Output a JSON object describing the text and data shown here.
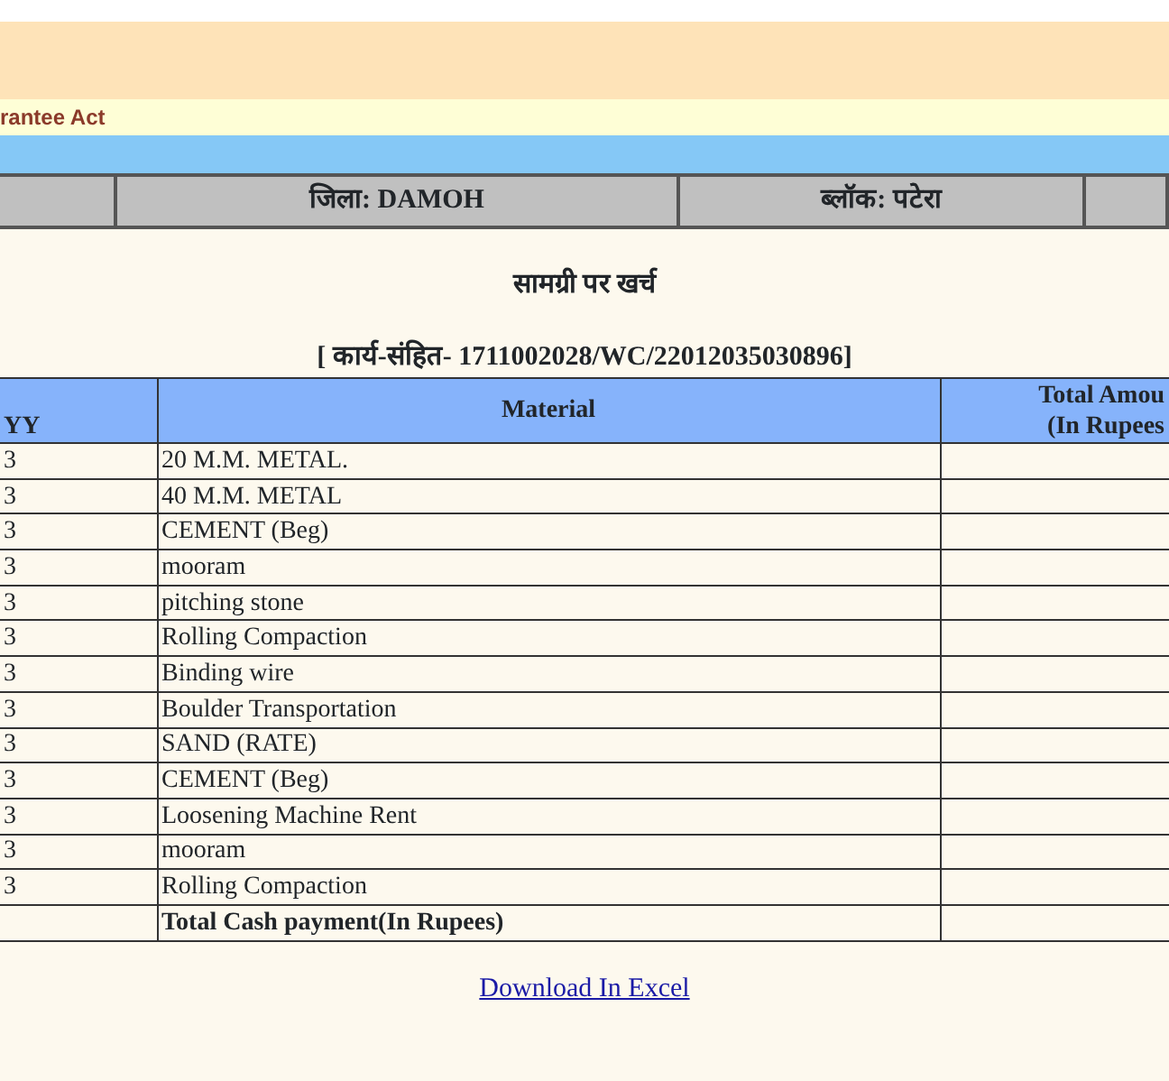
{
  "banner": {
    "text": "rantee Act"
  },
  "location_cells": [
    "जिला: DAMOH",
    "ब्लॉक: पटेरा"
  ],
  "title": "सामग्री पर खर्च",
  "work_code": "[ कार्य-संहित- 1711002028/WC/22012035030896]",
  "table": {
    "columns": [
      {
        "lines": [
          "YY"
        ]
      },
      {
        "lines": [
          "Material"
        ]
      },
      {
        "lines": [
          "Total Amou",
          "(In Rupees"
        ]
      }
    ],
    "rows": [
      {
        "column_1": "3",
        "material": "20 M.M. METAL."
      },
      {
        "column_1": "3",
        "material": "40 M.M. METAL"
      },
      {
        "column_1": "3",
        "material": "CEMENT (Beg)"
      },
      {
        "column_1": "3",
        "material": "mooram"
      },
      {
        "column_1": "3",
        "material": "pitching stone"
      },
      {
        "column_1": "3",
        "material": "Rolling Compaction"
      },
      {
        "column_1": "3",
        "material": "Binding wire"
      },
      {
        "column_1": "3",
        "material": "Boulder Transportation"
      },
      {
        "column_1": "3",
        "material": "SAND (RATE)"
      },
      {
        "column_1": "3",
        "material": "CEMENT (Beg)"
      },
      {
        "column_1": "3",
        "material": "Loosening Machine Rent"
      },
      {
        "column_1": "3",
        "material": "mooram"
      },
      {
        "column_1": "3",
        "material": "Rolling Compaction"
      }
    ],
    "total_row": {
      "label": "Total Cash payment(In Rupees)"
    }
  },
  "download_link": "Download In Excel"
}
